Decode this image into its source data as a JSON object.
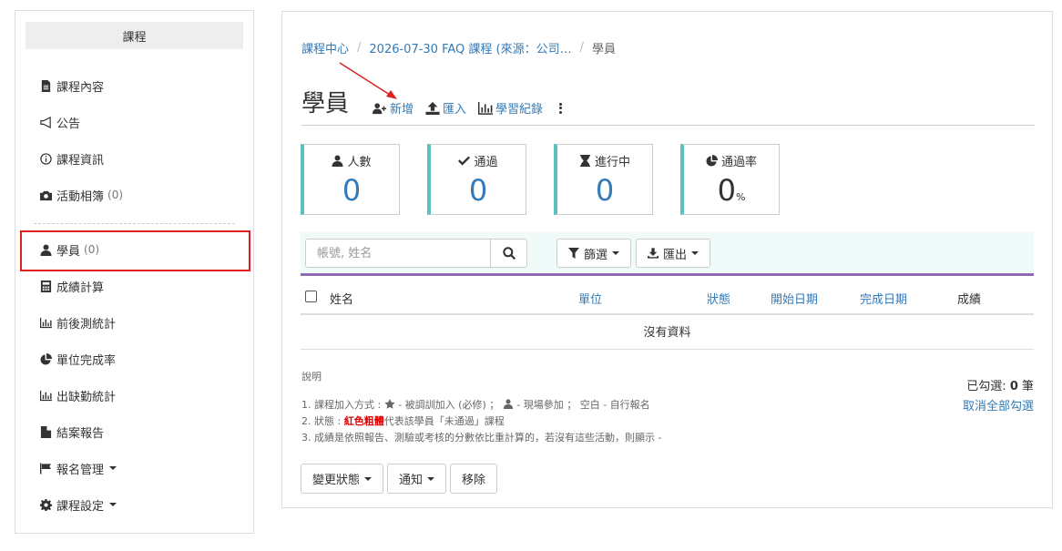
{
  "sidebar": {
    "header": "課程",
    "items": [
      {
        "label": "課程內容",
        "count": ""
      },
      {
        "label": "公告",
        "count": ""
      },
      {
        "label": "課程資訊",
        "count": ""
      },
      {
        "label": "活動相簿",
        "count": "(0)"
      },
      {
        "label": "學員",
        "count": "(0)"
      },
      {
        "label": "成績計算",
        "count": ""
      },
      {
        "label": "前後測統計",
        "count": ""
      },
      {
        "label": "單位完成率",
        "count": ""
      },
      {
        "label": "出缺勤統計",
        "count": ""
      },
      {
        "label": "結案報告",
        "count": ""
      },
      {
        "label": "報名管理",
        "count": ""
      },
      {
        "label": "課程設定",
        "count": ""
      }
    ]
  },
  "breadcrumb": {
    "home": "課程中心",
    "course": "2026-07-30 FAQ 課程 (來源：公司…",
    "current": "學員"
  },
  "page": {
    "title": "學員",
    "actions": {
      "add": "新增",
      "import": "匯入",
      "records": "學習紀錄"
    }
  },
  "stats": [
    {
      "label": "人數",
      "value": "0",
      "unit": ""
    },
    {
      "label": "通過",
      "value": "0",
      "unit": ""
    },
    {
      "label": "進行中",
      "value": "0",
      "unit": ""
    },
    {
      "label": "通過率",
      "value": "0",
      "unit": "%"
    }
  ],
  "filters": {
    "search_placeholder": "帳號, 姓名",
    "filter_label": "篩選",
    "export_label": "匯出"
  },
  "table": {
    "columns": [
      "姓名",
      "單位",
      "狀態",
      "開始日期",
      "完成日期",
      "成績"
    ],
    "empty": "沒有資料"
  },
  "notes": {
    "title": "說明",
    "line1_prefix": "1. 課程加入方式 :",
    "line1_mid": " - 被調訓加入 (必修) ； ",
    "line1_tail": " - 現場參加 ； 空白 - 自行報名",
    "line2_prefix": "2. 狀態 : ",
    "line2_red": "紅色粗體",
    "line2_tail": "代表該學員「未通過」課程",
    "line3": "3. 成績是依照報告、測驗或考核的分數依比重計算的，若沒有這些活動，則顯示 -"
  },
  "selection": {
    "prefix": "已勾選: ",
    "count": "0",
    "suffix": " 筆",
    "clear": "取消全部勾選"
  },
  "bottom_buttons": {
    "change_status": "變更狀態",
    "notify": "通知",
    "remove": "移除"
  },
  "colors": {
    "link": "#337ab7",
    "stat_accent": "#5bc0be",
    "table_rule": "#8d6bb5",
    "highlight": "#e02020"
  }
}
